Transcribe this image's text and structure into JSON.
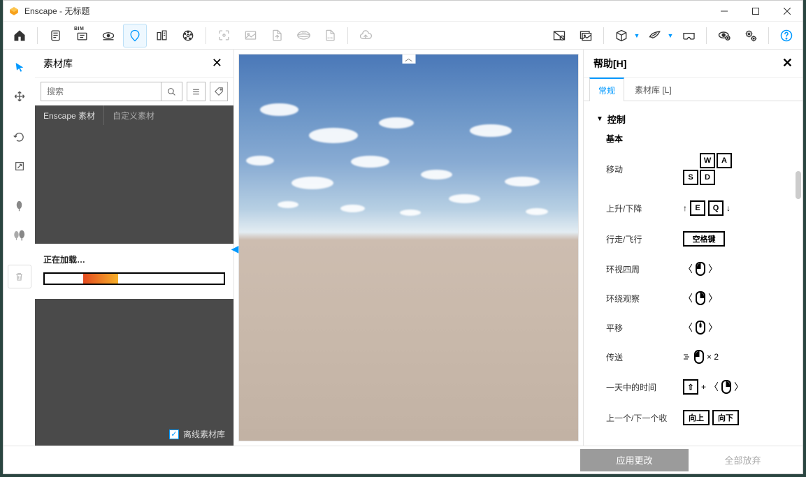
{
  "title": "Enscape - 无标题",
  "material_panel": {
    "title": "素材库",
    "search_placeholder": "搜索",
    "tabs": [
      "Enscape 素材",
      "自定义素材"
    ],
    "loading_text": "正在加载…",
    "offline_label": "离线素材库"
  },
  "help_panel": {
    "title": "帮助[H]",
    "tabs": [
      "常规",
      "素材库 [L]"
    ],
    "section": "控制",
    "subtitle": "基本",
    "rows": {
      "move": "移动",
      "updown": "上升/下降",
      "walkfly": "行走/飞行",
      "look": "环视四周",
      "orbit": "环绕观察",
      "pan": "平移",
      "teleport": "传送",
      "teleport_suffix": "× 2",
      "timeofday": "一天中的时间",
      "prevnext": "上一个/下一个收"
    },
    "keys": {
      "w": "W",
      "a": "A",
      "s": "S",
      "d": "D",
      "e": "E",
      "q": "Q",
      "space": "空格键",
      "up": "向上",
      "down": "向下"
    }
  },
  "bottom": {
    "apply": "应用更改",
    "discard": "全部放弃"
  }
}
